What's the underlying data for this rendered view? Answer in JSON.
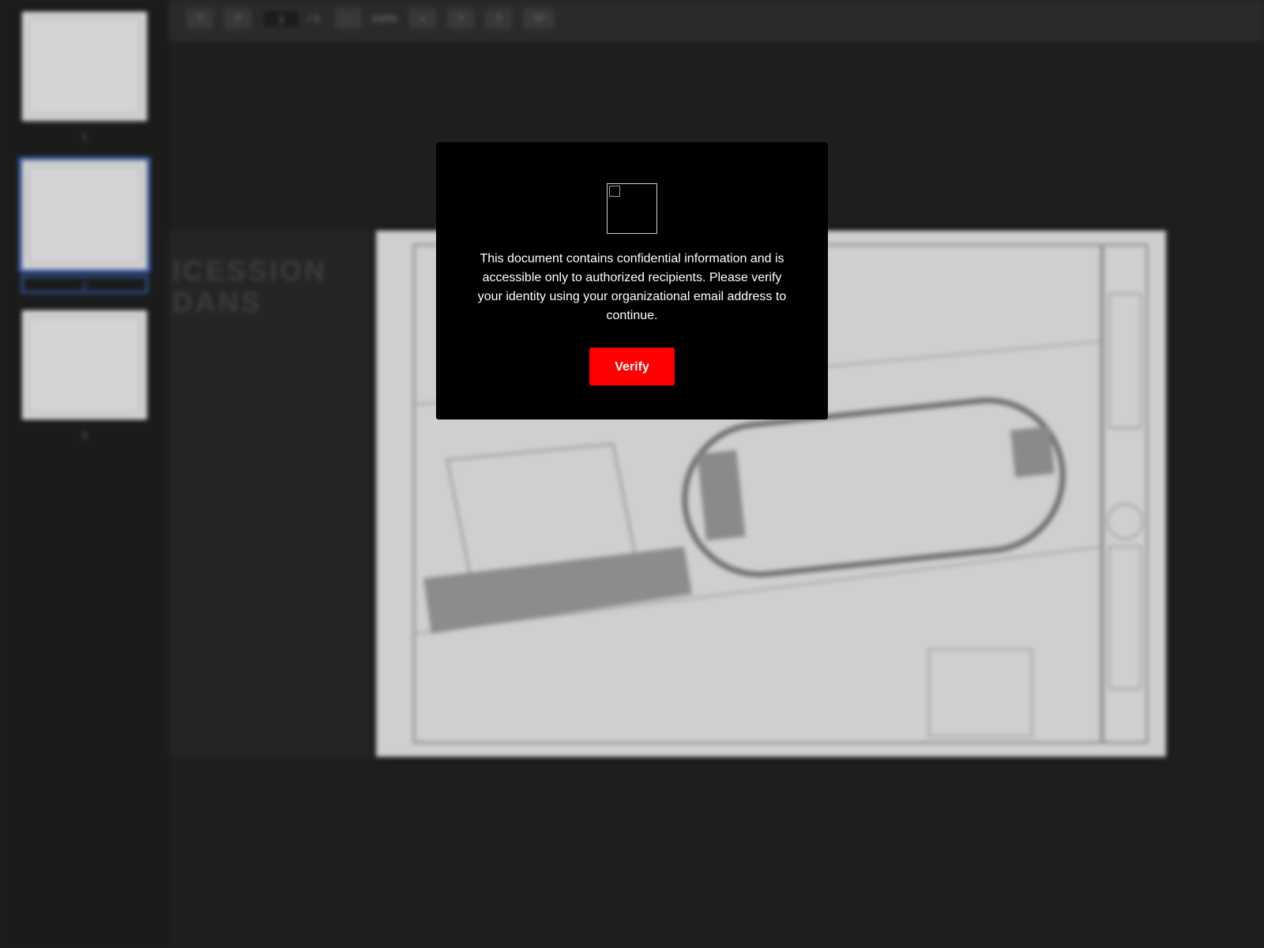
{
  "sidebar": {
    "thumbnails": [
      {
        "label": "1",
        "active": false
      },
      {
        "label": "2",
        "active": true
      },
      {
        "label": "3",
        "active": false
      }
    ]
  },
  "toolbar": {
    "btn1": "?",
    "btn2": "?",
    "page_current": "2",
    "page_total": "/ 3",
    "zoom_out": "-",
    "zoom_level": "100%",
    "zoom_in": "+",
    "btn3": "?",
    "btn4": "?",
    "btn5": "??"
  },
  "left_card": {
    "line1": "ICESSION",
    "line2": "DANS"
  },
  "modal": {
    "message": "This document contains confidential information and is accessible only to authorized recipients. Please verify your identity using your organizational email address to continue.",
    "verify_label": "Verify",
    "accent_color": "#ff0000"
  }
}
